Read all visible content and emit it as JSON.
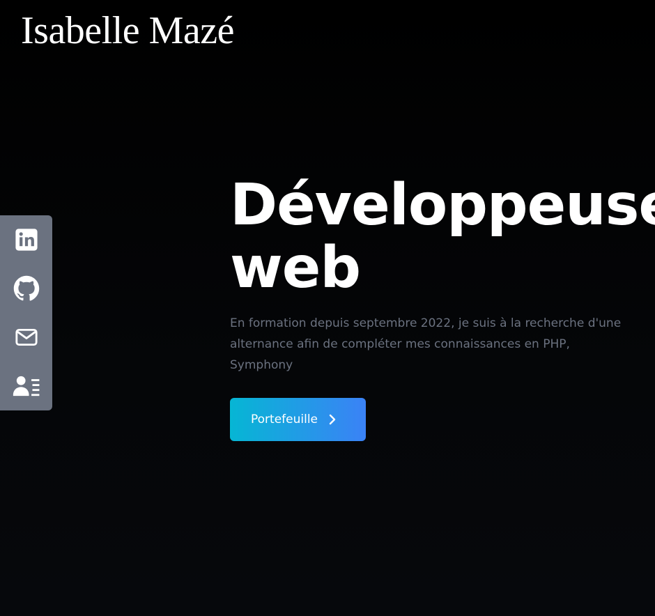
{
  "header": {
    "logo_text": "Isabelle Mazé"
  },
  "social": {
    "items": [
      {
        "icon": "linkedin-icon",
        "color": "#ffffff"
      },
      {
        "icon": "github-icon",
        "color": "#ffffff"
      },
      {
        "icon": "mail-icon",
        "color": "#ffffff"
      },
      {
        "icon": "resume-icon",
        "color": "#ffffff"
      }
    ],
    "bar_color": "#6b7280"
  },
  "hero": {
    "title_line1": "Développeuse",
    "title_line2": "web",
    "description": "En formation depuis septembre 2022, je suis à la recherche d'une alternance afin de compléter mes connaissances en PHP, Symphony",
    "cta_label": "Portefeuille",
    "cta_icon": "chevron-right-icon",
    "cta_gradient": [
      "#06b6d4",
      "#3b82f6"
    ]
  },
  "colors": {
    "background": "#000000",
    "text_primary": "#ffffff",
    "text_muted": "#6b7280"
  }
}
